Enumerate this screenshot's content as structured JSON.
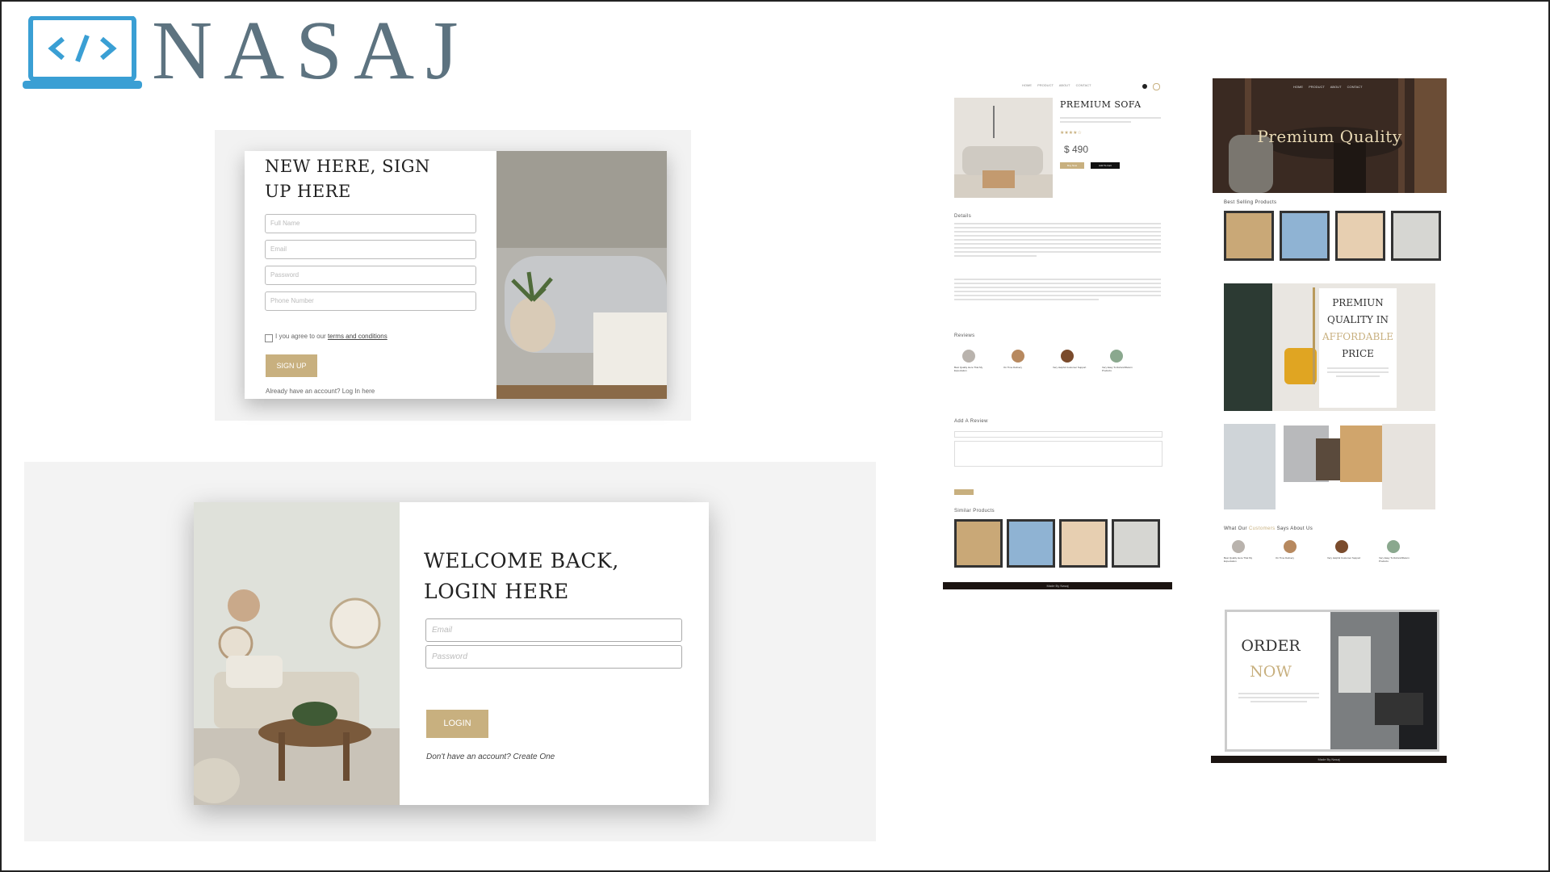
{
  "brand": {
    "name": "NASAJ",
    "icon": "laptop-code-icon",
    "color": "#5d7380",
    "icon_color": "#3a9fd4"
  },
  "accent": "#c8b07f",
  "signup": {
    "title": "NEW HERE, SIGN UP HERE",
    "fields": [
      "Full Name",
      "Email",
      "Password",
      "Phone Number"
    ],
    "agree_prefix": "I you agree to our ",
    "agree_link": "terms and conditions",
    "button": "SIGN UP",
    "have_account": "Already have an account? Log In here"
  },
  "login": {
    "title": "WELCOME BACK, LOGIN HERE",
    "email_placeholder": "Email",
    "password_placeholder": "Password",
    "button": "LOGIN",
    "create_prompt": "Don't have an account? Create One"
  },
  "product_page": {
    "nav": [
      "HOME",
      "PRODUCT",
      "ABOUT",
      "CONTACT"
    ],
    "product_title": "PREMIUM SOFA",
    "rating": "★★★★☆",
    "price": "$ 490",
    "buy_now": "Buy Now",
    "add_to_cart": "Add To Cart",
    "details_heading": "Details",
    "reviews_heading": "Reviews",
    "reviews": [
      "Best Quality Here That My Expectation",
      "On Time Delivery",
      "Very Helpful Customer Support",
      "Very Easy To Refund/Return Products"
    ],
    "add_review_heading": "Add A Review",
    "similar_heading": "Similar Products",
    "footer": "Made By Nasaj"
  },
  "home_page": {
    "nav": [
      "HOME",
      "PRODUCT",
      "ABOUT",
      "CONTACT"
    ],
    "hero_title": "Premium Quality",
    "best_selling_heading": "Best Selling Products",
    "promo": {
      "line1": "PREMIUN",
      "line2": "QUALITY IN",
      "line3": "AFFORDABLE",
      "line4": "PRICE"
    },
    "testimonials_heading_pre": "What Our ",
    "testimonials_heading_accent": "Customers",
    "testimonials_heading_post": " Says About Us",
    "testimonials": [
      "Best Quality Here That My Expectation",
      "On Time Delivery",
      "Very Helpful Customer Support",
      "Very Easy To Refund/Return Products"
    ],
    "order": {
      "line1": "ORDER",
      "line2": "NOW"
    },
    "footer": "Made By Nasaj"
  }
}
